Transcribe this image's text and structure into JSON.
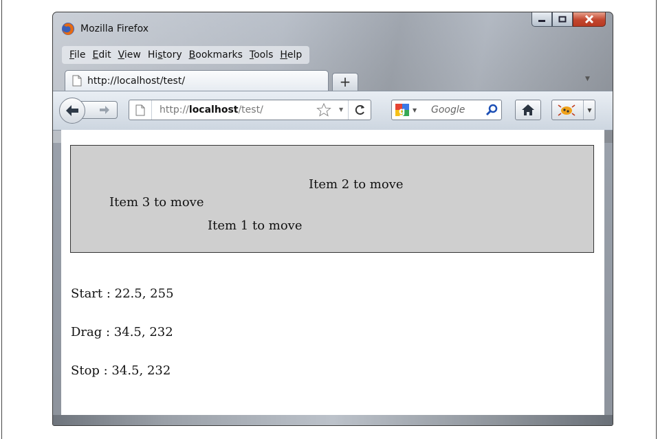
{
  "window": {
    "title": "Mozilla Firefox",
    "controls": [
      "minimize-icon",
      "maximize-icon",
      "close-icon"
    ]
  },
  "menubar": {
    "items": [
      "File",
      "Edit",
      "View",
      "History",
      "Bookmarks",
      "Tools",
      "Help"
    ]
  },
  "tabs": [
    {
      "title": "http://localhost/test/",
      "icon": "page-icon",
      "active": true
    }
  ],
  "new_tab_label": "+",
  "navbar": {
    "url_prefix": "http://",
    "url_host": "localhost",
    "url_path": "/test/",
    "search_placeholder": "Google",
    "icons": [
      "back-arrow-icon",
      "forward-arrow-icon",
      "page-icon",
      "star-icon",
      "reload-icon",
      "google-icon",
      "search-icon",
      "home-icon",
      "firebug-icon"
    ]
  },
  "content": {
    "drag_items": [
      {
        "label": "Item 2 to move"
      },
      {
        "label": "Item 3 to move"
      },
      {
        "label": "Item 1 to move"
      }
    ],
    "status": {
      "start": "Start : 22.5, 255",
      "drag": "Drag : 34.5, 232",
      "stop": "Stop : 34.5, 232"
    }
  },
  "colors": {
    "drag_area_bg": "#cfcfcf",
    "close_button": "#c2462e",
    "chrome_bg": "#cdd6e0"
  }
}
